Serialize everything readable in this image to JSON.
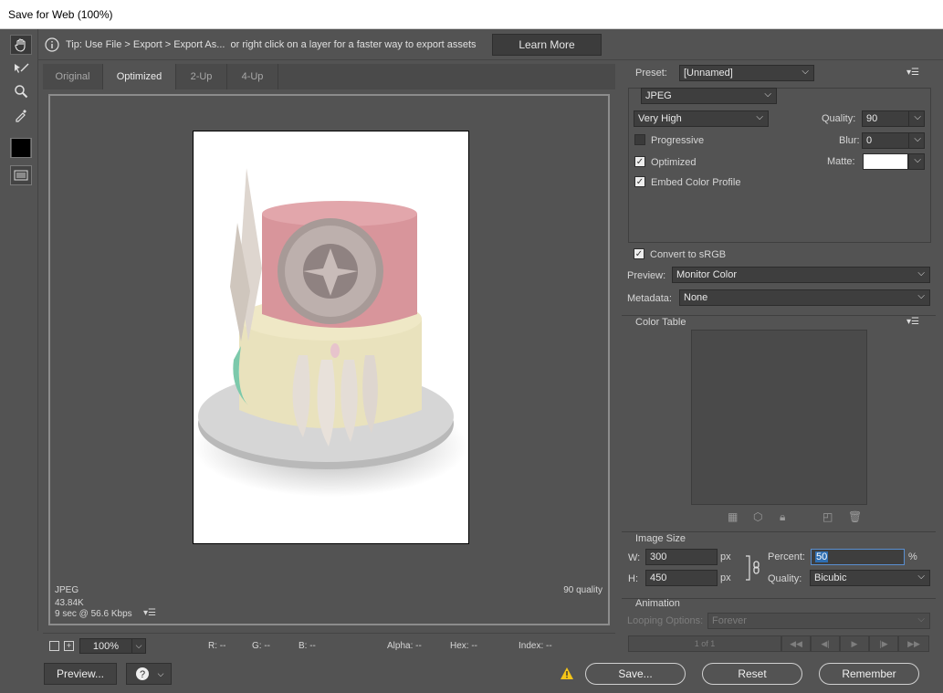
{
  "window": {
    "title": "Save for Web (100%)"
  },
  "tip": {
    "text": "Tip: Use File > Export > Export As...  or right click on a layer for a faster way to export assets",
    "learn_more": "Learn More"
  },
  "tools": [
    {
      "name": "hand-tool",
      "icon": "hand-icon"
    },
    {
      "name": "slice-select-tool",
      "icon": "slice-select-icon"
    },
    {
      "name": "zoom-tool",
      "icon": "magnifier-icon"
    },
    {
      "name": "eyedropper-tool",
      "icon": "eyedropper-icon"
    },
    {
      "name": "eyedropper-color",
      "icon": "color-swatch-icon"
    },
    {
      "name": "toggle-slices",
      "icon": "slices-visibility-icon"
    }
  ],
  "tabs": [
    {
      "label": "Original",
      "selected": false
    },
    {
      "label": "Optimized",
      "selected": true
    },
    {
      "label": "2-Up",
      "selected": false
    },
    {
      "label": "4-Up",
      "selected": false
    }
  ],
  "preview_info": {
    "format": "JPEG",
    "size": "43.84K",
    "time": "9 sec @ 56.6 Kbps",
    "quality": "90 quality"
  },
  "status": {
    "zoom": "100%",
    "r": "R: --",
    "g": "G: --",
    "b": "B: --",
    "alpha": "Alpha: --",
    "hex": "Hex: --",
    "index": "Index: --"
  },
  "bottom": {
    "preview": "Preview...",
    "save": "Save...",
    "reset": "Reset",
    "remember": "Remember"
  },
  "settings": {
    "preset_label": "Preset:",
    "preset_value": "[Unnamed]",
    "format": "JPEG",
    "quality_level": "Very High",
    "quality_label": "Quality:",
    "quality_value": "90",
    "progressive": "Progressive",
    "progressive_checked": false,
    "blur_label": "Blur:",
    "blur_value": "0",
    "optimized": "Optimized",
    "optimized_checked": true,
    "matte_label": "Matte:",
    "matte_color": "#ffffff",
    "embed_profile": "Embed Color Profile",
    "embed_checked": true,
    "convert_srgb": "Convert to sRGB",
    "convert_checked": true,
    "preview_label": "Preview:",
    "preview_value": "Monitor Color",
    "metadata_label": "Metadata:",
    "metadata_value": "None"
  },
  "color_table": {
    "title": "Color Table"
  },
  "image_size": {
    "title": "Image Size",
    "w_label": "W:",
    "w_value": "300",
    "h_label": "H:",
    "h_value": "450",
    "px": "px",
    "percent_label": "Percent:",
    "percent_value": "50",
    "percent_unit": "%",
    "quality_label": "Quality:",
    "quality_value": "Bicubic"
  },
  "animation": {
    "title": "Animation",
    "looping_label": "Looping Options:",
    "looping_value": "Forever",
    "frame": "1 of 1"
  },
  "colors": {
    "panel": "#535353",
    "field": "#3e3e3e",
    "warning": "#f5c518",
    "highlight": "#2f6fb3"
  }
}
